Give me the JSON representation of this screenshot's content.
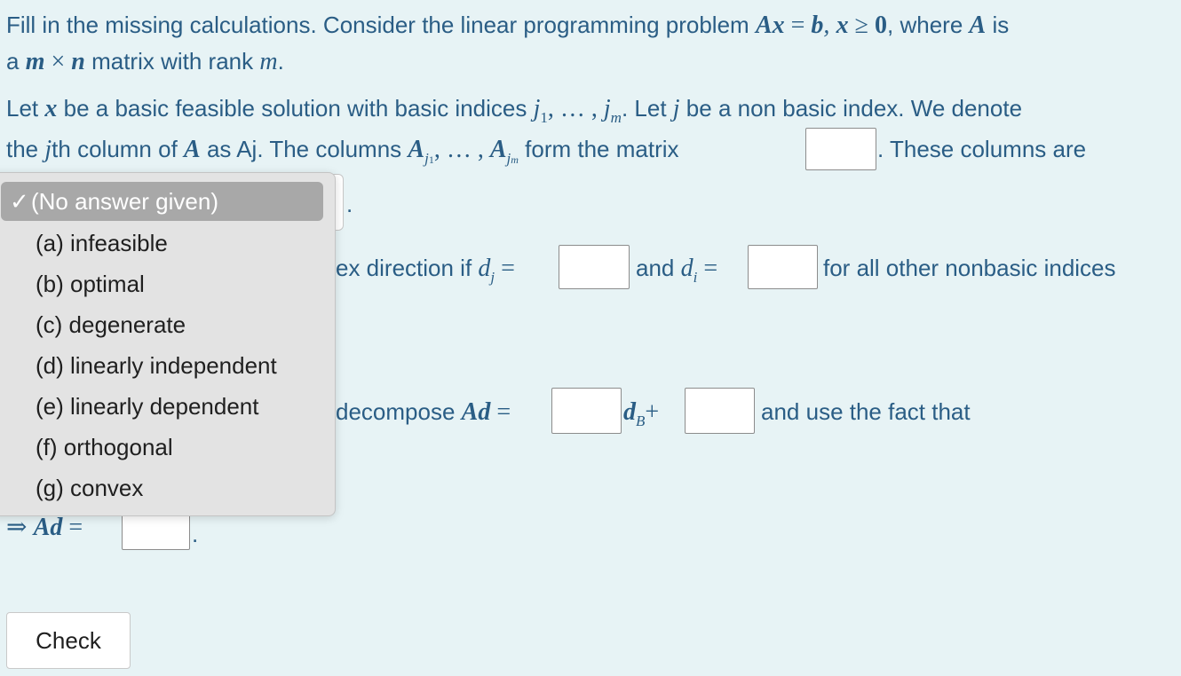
{
  "intro": {
    "line1_text": "Fill in the missing calculations. Consider the linear programming problem",
    "line1_where": ", where",
    "line1_is": "is",
    "line2_a": "a",
    "line2_mid": "matrix with rank",
    "line2_end": "."
  },
  "para": {
    "let_x": "Let",
    "bfs_text": "be a basic feasible solution with basic indices",
    "let_j": ". Let",
    "nonbasic_text": "be a non basic index. We denote",
    "the": "the",
    "jth_text": "th column of",
    "as_aj": "as Aj. The columns",
    "form_matrix": "form the matrix",
    "these_cols": ". These columns are"
  },
  "row_direction": {
    "prefix_partial": "ex direction if",
    "and": "and",
    "suffix": "for all other nonbasic indices"
  },
  "row_decompose": {
    "prefix_partial": "decompose",
    "and_use": "and use the fact that"
  },
  "implies_row": {
    "symbol": "⇒",
    "period": "."
  },
  "dropdown": {
    "options": [
      {
        "label": "(No answer given)",
        "selected": true
      },
      {
        "label": "(a) infeasible",
        "selected": false
      },
      {
        "label": "(b) optimal",
        "selected": false
      },
      {
        "label": "(c) degenerate",
        "selected": false
      },
      {
        "label": "(d) linearly independent",
        "selected": false
      },
      {
        "label": "(e) linearly dependent",
        "selected": false
      },
      {
        "label": "(f) orthogonal",
        "selected": false
      },
      {
        "label": "(g) convex",
        "selected": false
      }
    ],
    "check_mark": "✓"
  },
  "buttons": {
    "check_label": "Check"
  },
  "colors": {
    "text": "#2a5d85",
    "background": "#e7f3f5",
    "popup_bg": "#e3e3e3",
    "selected_bg": "#a8a8a8"
  }
}
